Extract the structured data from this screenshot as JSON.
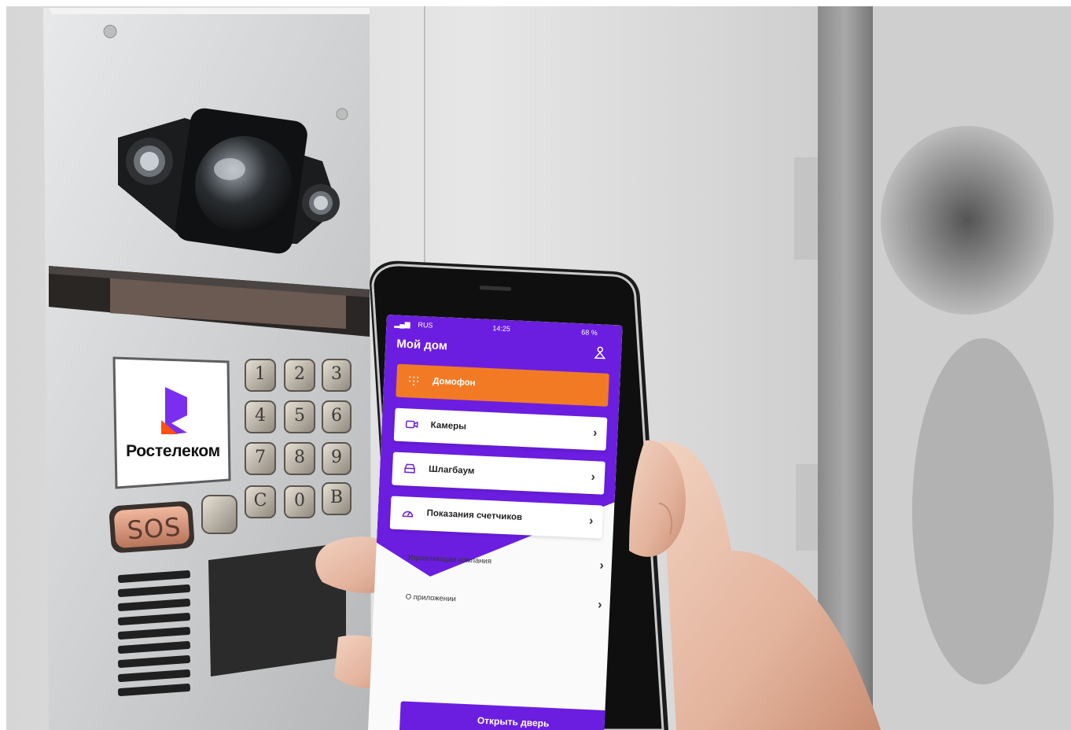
{
  "intercom": {
    "brand": "Ростелеком",
    "keys": [
      "1",
      "2",
      "3",
      "4",
      "5",
      "6",
      "7",
      "8",
      "9",
      "C",
      "0",
      "B"
    ],
    "sos_label": "SOS",
    "colors": {
      "brand_purple": "#7a2ff0",
      "brand_orange": "#ff4f12",
      "panel": "#d9dbdd",
      "sos_copper": "#c98b72"
    }
  },
  "phone": {
    "status": {
      "carrier": "RUS",
      "time": "14:25",
      "battery": "68 %"
    },
    "title": "Мой дом",
    "profile_icon": "user-icon",
    "menu_items": [
      {
        "label": "Домофон",
        "icon": "keypad-icon"
      },
      {
        "label": "Камеры",
        "icon": "camera-icon"
      },
      {
        "label": "Шлагбаум",
        "icon": "car-icon"
      },
      {
        "label": "Показания счетчиков",
        "icon": "gauge-icon"
      }
    ],
    "plain_items": [
      {
        "label": "Управляющая компания"
      },
      {
        "label": "О приложении"
      }
    ],
    "open_door": "Открыть дверь",
    "colors": {
      "purple": "#6b1ee0",
      "orange": "#f27a25"
    }
  }
}
